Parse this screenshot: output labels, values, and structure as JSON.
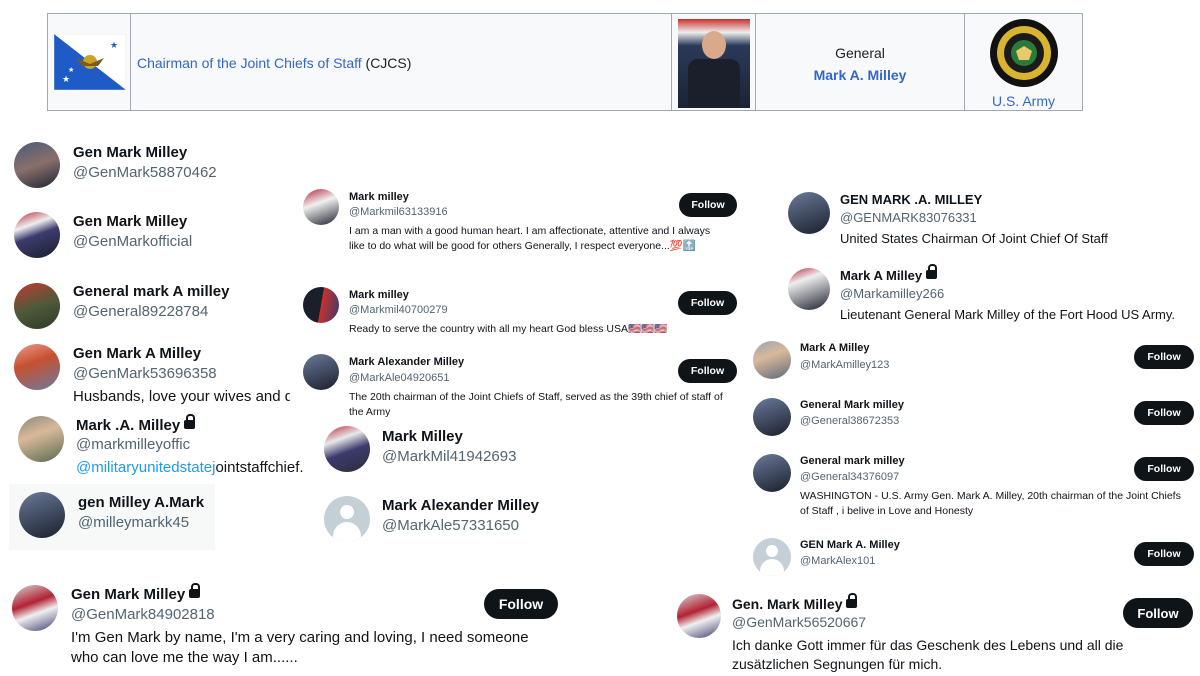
{
  "wiki_row": {
    "office_link": "Chairman of the Joint Chiefs of Staff",
    "office_abbr": "(CJCS)",
    "rank": "General",
    "name": "Mark A. Milley",
    "branch": "U.S. Army"
  },
  "follow_label": "Follow",
  "accounts": [
    {
      "name": "Gen Mark Milley",
      "handle": "@GenMark58870462"
    },
    {
      "name": "Gen Mark Milley",
      "handle": "@GenMarkofficial"
    },
    {
      "name": "General mark A milley",
      "handle": "@General89228784"
    },
    {
      "name": "Gen Mark A Milley",
      "handle": "@GenMark53696358",
      "bio": "Husbands, love your wives and do"
    },
    {
      "name": "Mark .A. Milley",
      "handle": "@markmilleyoffic",
      "bio_link": "@militaryunitedstatej",
      "bio_rest": "ointstaffchief."
    },
    {
      "name": "gen Milley A.Mark",
      "handle": "@milleymarkk45"
    },
    {
      "name": "Gen Mark Milley",
      "handle": "@GenMark84902818",
      "bio": "I'm Gen Mark by name, I'm a very caring and loving, I need someone who can love me the way I am......"
    },
    {
      "name": "Mark milley",
      "handle": "@Markmil63133916",
      "bio": "I am a man with a good human heart. I am affectionate, attentive and I always like to do what will be good for others Generally, I respect everyone...💯🔝"
    },
    {
      "name": "Mark milley",
      "handle": "@Markmil40700279",
      "bio": "Ready to serve the country with all my heart God bless USA🇺🇸🇺🇸🇺🇸"
    },
    {
      "name": "Mark Alexander Milley",
      "handle": "@MarkAle04920651",
      "bio": "The 20th chairman of the Joint Chiefs of Staff, served as the 39th chief of staff of the Army"
    },
    {
      "name": "Mark Milley",
      "handle": "@MarkMil41942693"
    },
    {
      "name": "Mark Alexander Milley",
      "handle": "@MarkAle57331650"
    },
    {
      "name": "GEN MARK .A. MILLEY",
      "handle": "@GENMARK83076331",
      "bio": "United States Chairman Of Joint Chief Of Staff"
    },
    {
      "name": "Mark A Milley",
      "handle": "@Markamilley266",
      "bio": "Lieutenant General Mark Milley of the Fort Hood US Army."
    },
    {
      "name": "Mark A Milley",
      "handle": "@MarkAmilley123"
    },
    {
      "name": "General Mark milley",
      "handle": "@General38672353"
    },
    {
      "name": "General mark milley",
      "handle": "@General34376097",
      "bio": "WASHINGTON - U.S. Army Gen. Mark A. Milley, 20th chairman of the Joint Chiefs of Staff , i belive in Love and Honesty"
    },
    {
      "name": "GEN Mark A. Milley",
      "handle": "@MarkAlex101"
    },
    {
      "name": "Gen. Mark Milley",
      "handle": "@GenMark56520667",
      "bio": "Ich danke Gott immer für das Geschenk des Lebens und all die zusätzlichen Segnungen für mich."
    }
  ]
}
